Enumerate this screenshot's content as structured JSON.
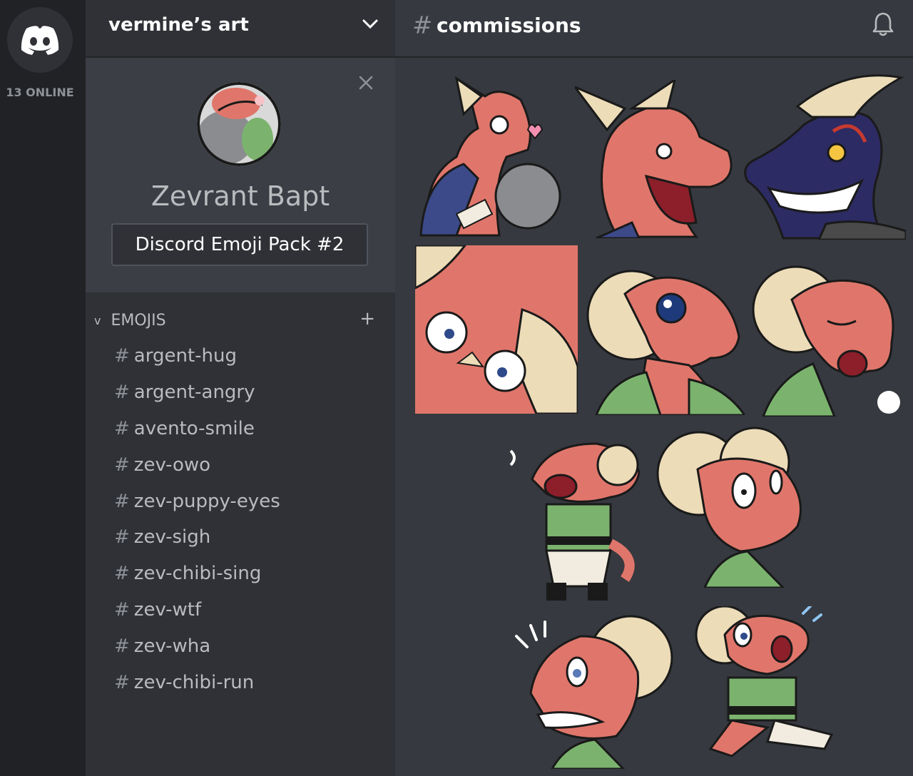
{
  "rail": {
    "online_label": "13 ONLINE"
  },
  "server": {
    "name": "vermine’s art"
  },
  "profile": {
    "name": "Zevrant Bapt",
    "button_label": "Discord Emoji Pack #2"
  },
  "emoji_section": {
    "header": "EMOJIS",
    "caret": "v",
    "add": "+"
  },
  "channels": [
    {
      "hash": "#",
      "label": "argent-hug"
    },
    {
      "hash": "#",
      "label": "argent-angry"
    },
    {
      "hash": "#",
      "label": "avento-smile"
    },
    {
      "hash": "#",
      "label": "zev-owo"
    },
    {
      "hash": "#",
      "label": "zev-puppy-eyes"
    },
    {
      "hash": "#",
      "label": "zev-sigh"
    },
    {
      "hash": "#",
      "label": "zev-chibi-sing"
    },
    {
      "hash": "#",
      "label": "zev-wtf"
    },
    {
      "hash": "#",
      "label": "zev-wha"
    },
    {
      "hash": "#",
      "label": "zev-chibi-run"
    }
  ],
  "main": {
    "hash": "#",
    "channel": "commissions"
  },
  "icons": {
    "logo": "discord-logo-icon",
    "chevron": "chevron-down-icon",
    "close": "close-icon",
    "bell": "bell-icon"
  },
  "colors": {
    "rail": "#202225",
    "sidebar": "#2f3136",
    "card": "#3b3e45",
    "main": "#36393f",
    "skin": "#e0766b",
    "horn": "#ecdcb8",
    "shirt": "#7bb36e",
    "villain": "#2d2b63"
  }
}
